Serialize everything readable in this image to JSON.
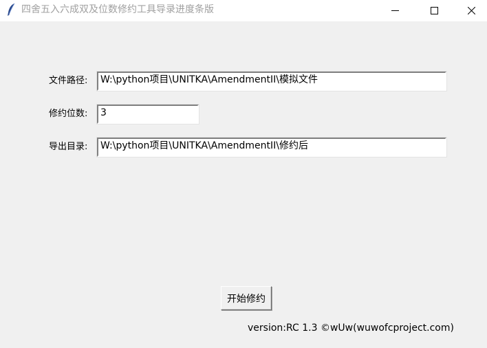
{
  "window": {
    "title": "四舍五入六成双及位数修约工具导录进度条版",
    "icon": "feather-icon",
    "controls": {
      "minimize": "minimize-icon",
      "maximize": "maximize-icon",
      "close": "close-icon"
    }
  },
  "form": {
    "file_path": {
      "label": "文件路径:",
      "value": "W:\\python项目\\UNITKA\\AmendmentII\\模拟文件"
    },
    "digits": {
      "label": "修约位数:",
      "value": "3"
    },
    "output_dir": {
      "label": "导出目录:",
      "value": "W:\\python项目\\UNITKA\\AmendmentII\\修约后"
    }
  },
  "actions": {
    "start_label": "开始修约"
  },
  "footer": {
    "version": "version:RC 1.3 ©wUw(wuwofcproject.com)"
  }
}
